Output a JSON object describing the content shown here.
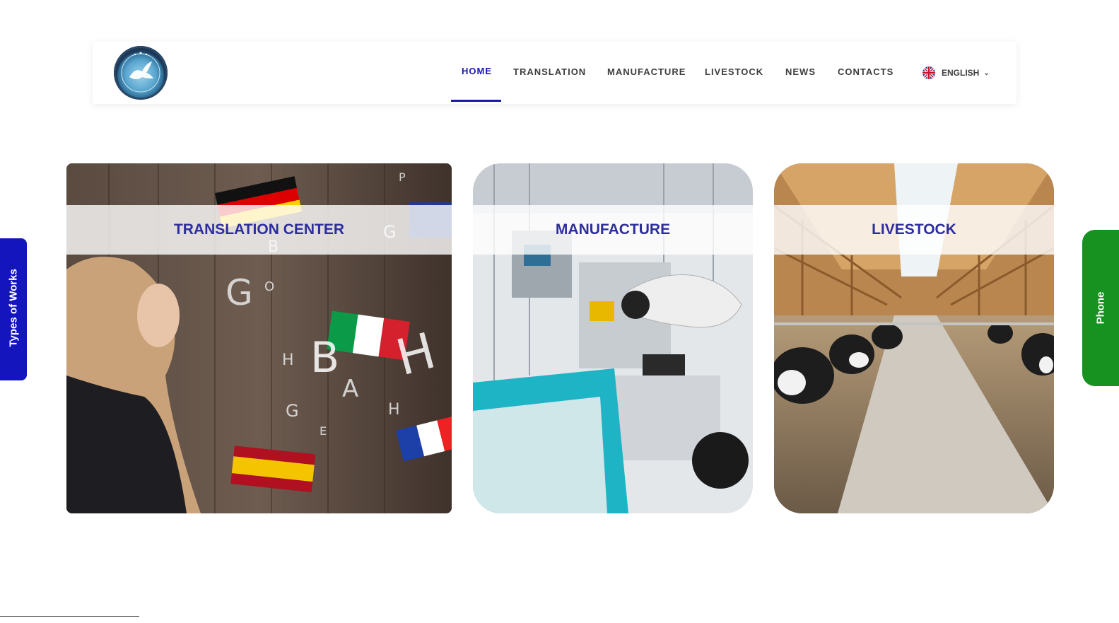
{
  "header": {
    "logo_name": "company-logo",
    "nav": [
      {
        "label": "HOME",
        "active": true
      },
      {
        "label": "TRANSLATION",
        "active": false
      },
      {
        "label": "MANUFACTURE",
        "active": false
      },
      {
        "label": "LIVESTOCK",
        "active": false
      },
      {
        "label": "NEWS",
        "active": false
      },
      {
        "label": "CONTACTS",
        "active": false
      }
    ],
    "language": {
      "label": "ENGLISH",
      "flag": "uk-flag-icon"
    }
  },
  "cards": [
    {
      "title": "TRANSLATION CENTER"
    },
    {
      "title": "MANUFACTURE"
    },
    {
      "title": "LIVESTOCK"
    }
  ],
  "side_tabs": {
    "left": "Types of Works",
    "right": "Phone"
  },
  "colors": {
    "accent": "#1a1aa6",
    "left_tab": "#1515bd",
    "right_tab": "#17911f",
    "card_title": "#2d2d9e"
  }
}
